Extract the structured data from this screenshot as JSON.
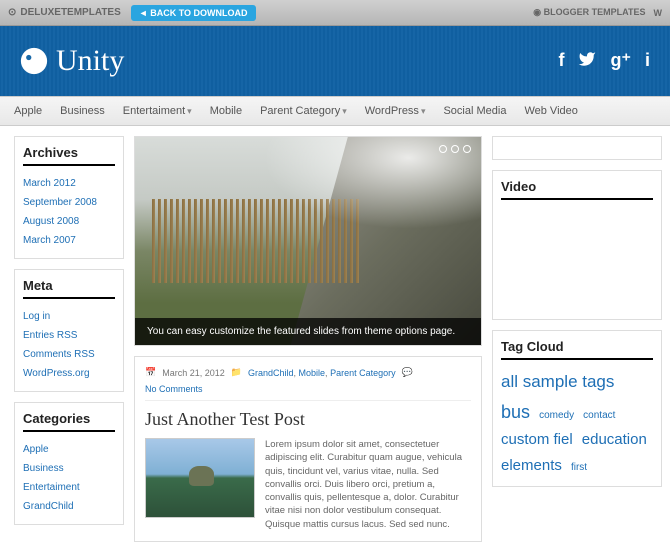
{
  "topbar": {
    "brand": "DELUXETEMPLATES",
    "back_btn": "◄ BACK TO DOWNLOAD",
    "blogger": "BLOGGER TEMPLATES",
    "wp": "W"
  },
  "header": {
    "title": "Unity",
    "social": [
      "f",
      "twitter",
      "g+",
      "i"
    ]
  },
  "nav": [
    {
      "label": "Apple",
      "dd": false
    },
    {
      "label": "Business",
      "dd": false
    },
    {
      "label": "Entertaiment",
      "dd": true
    },
    {
      "label": "Mobile",
      "dd": false
    },
    {
      "label": "Parent Category",
      "dd": true
    },
    {
      "label": "WordPress",
      "dd": true
    },
    {
      "label": "Social Media",
      "dd": false
    },
    {
      "label": "Web Video",
      "dd": false
    }
  ],
  "archives": {
    "title": "Archives",
    "items": [
      "March 2012",
      "September 2008",
      "August 2008",
      "March 2007"
    ]
  },
  "meta": {
    "title": "Meta",
    "items": [
      "Log in",
      "Entries RSS",
      "Comments RSS",
      "WordPress.org"
    ]
  },
  "categories": {
    "title": "Categories",
    "items": [
      "Apple",
      "Business",
      "Entertaiment",
      "GrandChild"
    ]
  },
  "slider": {
    "caption": "You can easy customize the featured slides from theme options page."
  },
  "post": {
    "date": "March 21, 2012",
    "cats": [
      "GrandChild",
      "Mobile",
      "Parent Category"
    ],
    "comments": "No Comments",
    "title": "Just Another Test Post",
    "body": "Lorem ipsum dolor sit amet, consectetuer adipiscing elit. Curabitur quam augue, vehicula quis, tincidunt vel, varius vitae, nulla. Sed convallis orci. Duis libero orci, pretium a, convallis quis, pellentesque a, dolor. Curabitur vitae nisi non dolor vestibulum consequat. Quisque mattis cursus lacus. Sed sed nunc."
  },
  "video": {
    "title": "Video"
  },
  "tagcloud": {
    "title": "Tag Cloud",
    "tags": [
      {
        "t": "all sample tags",
        "s": "s1"
      },
      {
        "t": "bus",
        "s": "s4"
      },
      {
        "t": "comedy",
        "s": "s2"
      },
      {
        "t": "contact",
        "s": "s2"
      },
      {
        "t": "custom fiel",
        "s": "s3"
      },
      {
        "t": "education",
        "s": "s3"
      },
      {
        "t": "elements",
        "s": "s3"
      },
      {
        "t": "first",
        "s": "s2"
      }
    ]
  }
}
